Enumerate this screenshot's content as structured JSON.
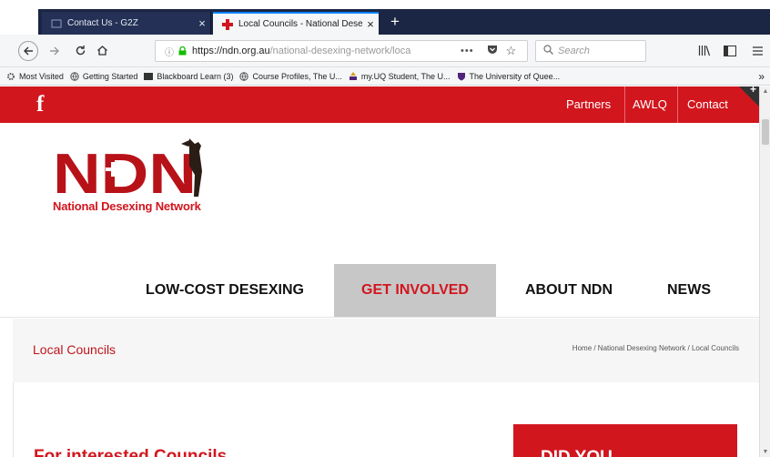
{
  "browser": {
    "tabs": [
      {
        "label": "Contact Us - G2Z",
        "close": "×",
        "active": false
      },
      {
        "label": "Local Councils - National Dese",
        "close": "×",
        "active": true
      }
    ],
    "new_tab": "+",
    "url": {
      "host": "https://ndn.org.au",
      "path": "/national-desexing-network/loca"
    },
    "url_more": "•••",
    "search_placeholder": "Search",
    "bookmarks": [
      "Most Visited",
      "Getting Started",
      "Blackboard Learn (3)",
      "Course Profiles, The U...",
      "my.UQ Student, The U...",
      "The University of Quee..."
    ],
    "bookmarks_overflow": "»"
  },
  "site": {
    "social": "f",
    "top_links": [
      "Partners",
      "AWLQ",
      "Contact"
    ],
    "logo_text": "NDN",
    "logo_tagline": "National Desexing Network",
    "nav": [
      "LOW-COST DESEXING",
      "GET INVOLVED",
      "ABOUT NDN",
      "NEWS"
    ],
    "active_nav": "GET INVOLVED",
    "page_title": "Local Councils",
    "breadcrumb": "Home  /  National Desexing Network  /  Local Councils",
    "intro_heading": "For interested Councils",
    "sidebar_box_text": "DID YOU"
  },
  "colors": {
    "brand_red": "#d2161e",
    "tab_dark": "#1b2544",
    "active_nav_bg": "#c7c7c7"
  }
}
